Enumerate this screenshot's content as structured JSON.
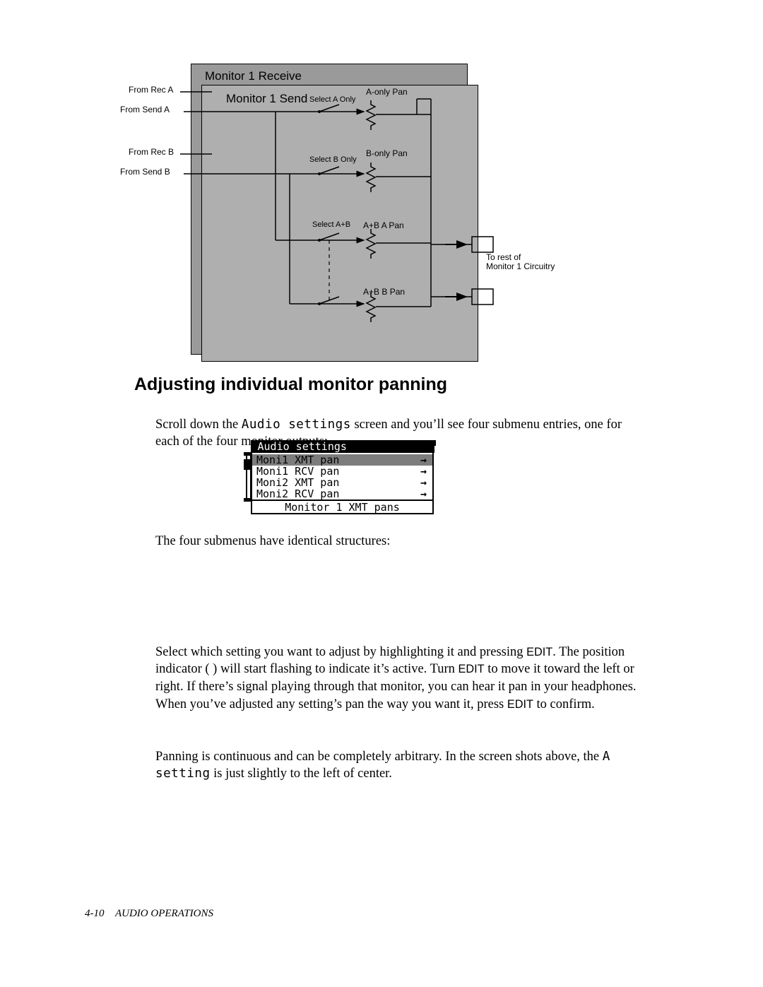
{
  "diagram": {
    "back_title": "Monitor 1 Receive",
    "front_title": "Monitor 1 Send",
    "inputs": {
      "rec_a": "From Rec A",
      "send_a": "From Send A",
      "rec_b": "From Rec B",
      "send_b": "From Send B"
    },
    "select": {
      "a": "Select A Only",
      "b": "Select B Only",
      "ab": "Select A+B"
    },
    "pan": {
      "a": "A-only Pan",
      "b": "B-only  Pan",
      "ab_a": "A+B  A Pan",
      "ab_b": "A+B  B Pan"
    },
    "output": "To rest of\nMonitor 1 Circuitry"
  },
  "heading": "Adjusting individual monitor panning",
  "para1_a": "Scroll down the ",
  "para1_code": "Audio settings",
  "para1_b": " screen and you’ll see four submenu entries, one for each of the four monitor outputs:",
  "lcd": {
    "title": "Audio settings",
    "items": [
      "Moni1 XMT pan",
      "Moni1 RCV pan",
      "Moni2 XMT pan",
      "Moni2 RCV pan"
    ],
    "footer": "Monitor 1 XMT pans"
  },
  "para2": "The four submenus have identical structures:",
  "para3_a": "Select which setting you want to adjust by highlighting it and pressing ",
  "para3_edit1": "EDIT",
  "para3_b": ". The position indicator (   ) will start flashing to indicate it’s active. Turn ",
  "para3_edit2": "EDIT",
  "para3_c": " to move it toward the left or right. If there’s signal playing through that monitor, you can hear it pan in your headphones. When you’ve adjusted any setting’s pan the way you want it, press ",
  "para3_edit3": "EDIT",
  "para3_d": " to confirm.",
  "para4_a": "Panning is continuous and can be completely arbitrary. In the screen shots above, the ",
  "para4_code": "A setting",
  "para4_b": " is just slightly to the left of center.",
  "footer": {
    "page": "4-10",
    "chapter": "AUDIO OPERATIONS"
  }
}
